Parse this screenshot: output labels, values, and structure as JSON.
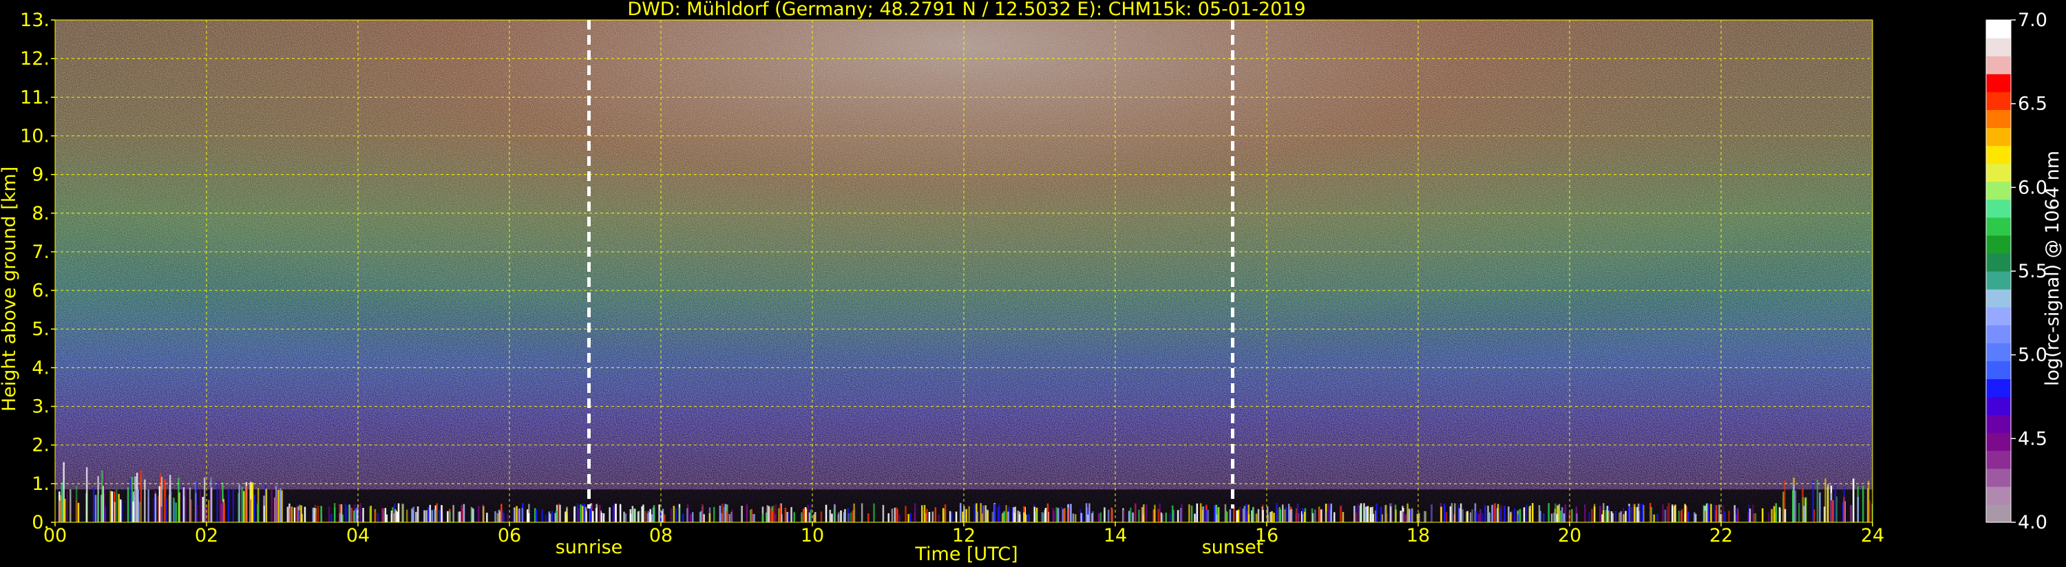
{
  "chart_data": {
    "type": "heatmap",
    "title": "DWD: Mühldorf (Germany; 48.2791 N / 12.5032 E):    CHM15k: 05-01-2019",
    "xlabel": "Time [UTC]",
    "ylabel": "Height above ground [km]",
    "xlim": [
      0,
      24
    ],
    "ylim": [
      0,
      13
    ],
    "x_ticks": [
      {
        "value": 0,
        "label": "00"
      },
      {
        "value": 2,
        "label": "02"
      },
      {
        "value": 4,
        "label": "04"
      },
      {
        "value": 6,
        "label": "06"
      },
      {
        "value": 8,
        "label": "08"
      },
      {
        "value": 10,
        "label": "10"
      },
      {
        "value": 12,
        "label": "12"
      },
      {
        "value": 14,
        "label": "14"
      },
      {
        "value": 16,
        "label": "16"
      },
      {
        "value": 18,
        "label": "18"
      },
      {
        "value": 20,
        "label": "20"
      },
      {
        "value": 22,
        "label": "22"
      },
      {
        "value": 24,
        "label": "24"
      }
    ],
    "y_ticks": [
      {
        "value": 0,
        "label": "0."
      },
      {
        "value": 1,
        "label": "1."
      },
      {
        "value": 2,
        "label": "2."
      },
      {
        "value": 3,
        "label": "3."
      },
      {
        "value": 4,
        "label": "4."
      },
      {
        "value": 5,
        "label": "5."
      },
      {
        "value": 6,
        "label": "6."
      },
      {
        "value": 7,
        "label": "7."
      },
      {
        "value": 8,
        "label": "8."
      },
      {
        "value": 9,
        "label": "9."
      },
      {
        "value": 10,
        "label": "10."
      },
      {
        "value": 11,
        "label": "11."
      },
      {
        "value": 12,
        "label": "12."
      },
      {
        "value": 13,
        "label": "13."
      }
    ],
    "grid": true,
    "markers": [
      {
        "name": "sunrise",
        "x": 7.05
      },
      {
        "name": "sunset",
        "x": 15.55
      }
    ],
    "colorbar": {
      "label": "log(rc-signal) @ 1064 nm",
      "range": [
        4.0,
        7.0
      ],
      "ticks": [
        {
          "value": 4.0,
          "label": "4.0"
        },
        {
          "value": 4.5,
          "label": "4.5"
        },
        {
          "value": 5.0,
          "label": "5.0"
        },
        {
          "value": 5.5,
          "label": "5.5"
        },
        {
          "value": 6.0,
          "label": "6.0"
        },
        {
          "value": 6.5,
          "label": "6.5"
        },
        {
          "value": 7.0,
          "label": "7.0"
        }
      ],
      "colors": [
        "#a898a8",
        "#b088b0",
        "#9e5aa0",
        "#8e2c96",
        "#7c0a8c",
        "#6a00a8",
        "#4400d8",
        "#1a1aff",
        "#3c60ff",
        "#5a7cff",
        "#7890ff",
        "#96a8ff",
        "#9ac4e6",
        "#3aa88e",
        "#1e8c50",
        "#1aa02a",
        "#2ec84a",
        "#52e690",
        "#a0f06a",
        "#e6f042",
        "#ffe600",
        "#ffb400",
        "#ff7800",
        "#ff3200",
        "#ff0000",
        "#f0b4b4",
        "#eee0e0",
        "#ffffff"
      ]
    }
  }
}
